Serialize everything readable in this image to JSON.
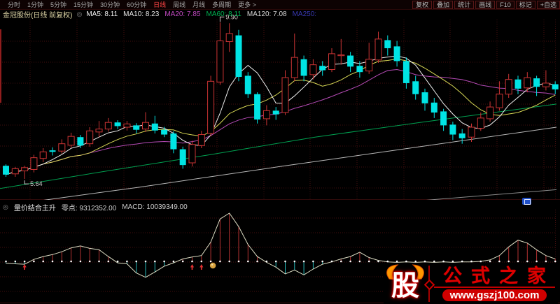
{
  "topbar": {
    "tabs": [
      "分时",
      "1分钟",
      "5分钟",
      "15分钟",
      "30分钟",
      "60分钟",
      "日线",
      "周线",
      "月线",
      "多周期",
      "更多 >"
    ],
    "active_tab": "日线",
    "buttons": [
      "复权",
      "叠加",
      "统计",
      "画线",
      "F10",
      "标记",
      "+自选"
    ]
  },
  "infobar": {
    "icon": "◎",
    "title": "金冠股份(日线 前复权)",
    "ma_labels": [
      {
        "label": "MA5:",
        "value": "8.11",
        "color": "#f0f0f0"
      },
      {
        "label": "MA10:",
        "value": "8.23",
        "color": "#e6e6e6"
      },
      {
        "label": "MA20:",
        "value": "7.85",
        "color": "#c14ac1"
      },
      {
        "label": "MA60:",
        "value": "8.11",
        "color": "#00b050"
      },
      {
        "label": "MA120:",
        "value": "7.08",
        "color": "#d8d8d8"
      },
      {
        "label": "MA250:",
        "value": "",
        "color": "#3838b0"
      }
    ]
  },
  "indicator_header": {
    "icon": "◎",
    "name": "量价结合主升",
    "field1_label": "零点:",
    "field1_value": "9312352.00",
    "field2_label": "MACD:",
    "field2_value": "10039349.00"
  },
  "watermark": {
    "logo_char": "股",
    "title": "公式之家",
    "url": "www.gszj100.com"
  },
  "chart_data": {
    "type": "candlestick",
    "high_label": "9.90",
    "low_label": "5.64",
    "price_max": 9.98,
    "price_min": 5.11,
    "colors": {
      "up": "#cc3434",
      "down": "#00e4e4",
      "ma5": "#efefef",
      "ma10": "#d8d855",
      "ma20": "#b54ab5",
      "ma60": "#00a050",
      "ma120": "#b8b8b8",
      "ma250": "#8a8a8a",
      "grid": "#420e0e",
      "hist_up": "#b43232",
      "hist_down": "#26b8b8",
      "curve": "#ddddc4",
      "dot": "#ffffff",
      "marker": "#e03030",
      "gold": "#d9a441",
      "label": "#d8c8c8"
    },
    "candles": [
      [
        6.0,
        6.04,
        5.7,
        5.76
      ],
      [
        5.78,
        5.97,
        5.7,
        5.92
      ],
      [
        5.86,
        6.0,
        5.64,
        5.95
      ],
      [
        5.9,
        6.3,
        5.82,
        6.22
      ],
      [
        6.2,
        6.48,
        6.1,
        6.38
      ],
      [
        6.42,
        6.5,
        6.28,
        6.38
      ],
      [
        6.4,
        6.72,
        6.33,
        6.6
      ],
      [
        6.56,
        6.9,
        6.48,
        6.8
      ],
      [
        6.78,
        6.84,
        6.48,
        6.55
      ],
      [
        6.6,
        7.05,
        6.52,
        6.95
      ],
      [
        6.92,
        7.22,
        6.78,
        7.0
      ],
      [
        7.0,
        7.3,
        6.93,
        7.18
      ],
      [
        7.18,
        7.24,
        7.0,
        7.08
      ],
      [
        7.05,
        7.22,
        6.96,
        7.14
      ],
      [
        7.1,
        7.16,
        6.88,
        6.98
      ],
      [
        7.0,
        7.46,
        6.92,
        7.18
      ],
      [
        7.15,
        7.36,
        6.88,
        6.96
      ],
      [
        6.98,
        7.06,
        6.78,
        6.85
      ],
      [
        6.88,
        6.94,
        6.34,
        6.45
      ],
      [
        6.45,
        6.52,
        5.92,
        6.02
      ],
      [
        6.08,
        6.68,
        5.98,
        6.58
      ],
      [
        6.55,
        6.95,
        6.48,
        6.85
      ],
      [
        6.88,
        8.45,
        6.8,
        8.3
      ],
      [
        8.28,
        9.9,
        8.2,
        9.4
      ],
      [
        9.38,
        9.88,
        9.1,
        9.6
      ],
      [
        9.55,
        9.7,
        8.3,
        8.42
      ],
      [
        8.45,
        8.55,
        7.85,
        7.95
      ],
      [
        7.95,
        8.0,
        7.15,
        7.26
      ],
      [
        7.28,
        7.65,
        7.1,
        7.5
      ],
      [
        7.5,
        7.6,
        7.25,
        7.4
      ],
      [
        7.45,
        8.6,
        7.38,
        8.4
      ],
      [
        8.4,
        9.6,
        8.3,
        8.95
      ],
      [
        8.9,
        9.0,
        8.3,
        8.45
      ],
      [
        8.48,
        8.9,
        8.35,
        8.75
      ],
      [
        8.72,
        8.85,
        8.45,
        8.6
      ],
      [
        8.62,
        9.2,
        8.55,
        9.05
      ],
      [
        9.0,
        9.45,
        8.75,
        9.02
      ],
      [
        9.0,
        9.1,
        8.55,
        8.7
      ],
      [
        8.72,
        8.85,
        8.4,
        8.55
      ],
      [
        8.58,
        9.35,
        8.5,
        8.9
      ],
      [
        8.88,
        9.65,
        8.8,
        9.45
      ],
      [
        9.42,
        9.55,
        9.0,
        9.2
      ],
      [
        9.25,
        9.4,
        8.7,
        8.85
      ],
      [
        8.85,
        8.95,
        8.1,
        8.25
      ],
      [
        8.3,
        8.45,
        7.8,
        7.95
      ],
      [
        8.0,
        8.1,
        7.5,
        7.7
      ],
      [
        7.72,
        7.85,
        7.3,
        7.45
      ],
      [
        7.48,
        7.55,
        6.95,
        7.1
      ],
      [
        7.12,
        7.2,
        6.7,
        6.85
      ],
      [
        6.88,
        7.0,
        6.6,
        6.75
      ],
      [
        6.78,
        7.15,
        6.65,
        7.05
      ],
      [
        7.02,
        7.45,
        6.95,
        7.3
      ],
      [
        7.28,
        7.75,
        7.2,
        7.6
      ],
      [
        7.58,
        8.3,
        7.5,
        7.95
      ],
      [
        7.95,
        8.5,
        7.85,
        8.35
      ],
      [
        8.35,
        8.45,
        7.95,
        8.1
      ],
      [
        8.12,
        8.55,
        8.0,
        8.4
      ],
      [
        8.38,
        8.45,
        7.9,
        8.15
      ],
      [
        8.15,
        8.6,
        8.05,
        8.25
      ],
      [
        8.22,
        8.3,
        7.95,
        8.08
      ]
    ],
    "ma60_points": [
      [
        0,
        5.38
      ],
      [
        150,
        5.85
      ],
      [
        300,
        6.3
      ],
      [
        450,
        6.78
      ],
      [
        600,
        7.18
      ],
      [
        795,
        7.68
      ]
    ],
    "ma120_points": [
      [
        0,
        4.9
      ],
      [
        200,
        5.42
      ],
      [
        400,
        5.98
      ],
      [
        600,
        6.52
      ],
      [
        795,
        7.05
      ]
    ],
    "ma250_points": [
      [
        400,
        4.75
      ],
      [
        600,
        5.05
      ],
      [
        795,
        5.35
      ]
    ],
    "indicator": {
      "values": [
        -4,
        -5,
        -6,
        4,
        10,
        14,
        20,
        28,
        32,
        27,
        24,
        10,
        -3,
        -5,
        -24,
        -33,
        -22,
        -10,
        -3,
        5,
        9,
        12,
        40,
        88,
        100,
        72,
        35,
        10,
        -2,
        -12,
        -26,
        -18,
        -28,
        -16,
        -6,
        -1,
        5,
        10,
        19,
        8,
        2,
        -1,
        -2,
        -1,
        -2,
        -1,
        -2,
        -1,
        -2,
        -1,
        -1,
        0,
        3,
        12,
        30,
        44,
        38,
        24,
        12,
        5
      ],
      "buy_arrow_indices": [
        2,
        20,
        21
      ],
      "gold_marker_index": 22
    }
  }
}
